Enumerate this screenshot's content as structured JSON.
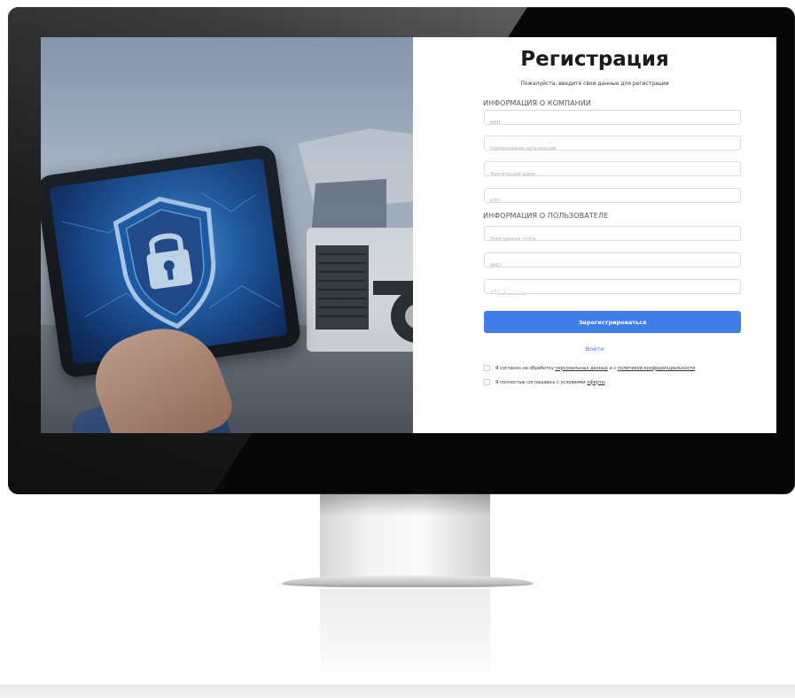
{
  "registration": {
    "title": "Регистрация",
    "subtitle": "Пожалуйста, введите свои данные для регистрации",
    "company_section": "ИНФОРМАЦИЯ О КОМПАНИИ",
    "user_section": "ИНФОРМАЦИЯ О ПОЛЬЗОВАТЕЛЕ",
    "fields": {
      "inn": "ИНН",
      "org_name": "Наименование организации",
      "address": "Фактический адрес",
      "kpp": "КПП",
      "email": "Электронная почта",
      "fio": "ФИО",
      "phone": "+7 (__) ___-__-__"
    },
    "submit_label": "Зарегистрироваться",
    "login_link": "Войти",
    "consent": {
      "personal_prefix": "Я согласен на обработку",
      "personal_link": "персональных данных",
      "personal_middle": "и с",
      "privacy_link": "политикой конфиденциальности",
      "offer_prefix": "Я полностью соглашаюсь с условиями",
      "offer_link": "оферты"
    }
  },
  "colors": {
    "accent": "#3f7ee8",
    "bezel": "#070707"
  },
  "icons": {
    "tablet_graphic": "shield-lock-icon"
  }
}
